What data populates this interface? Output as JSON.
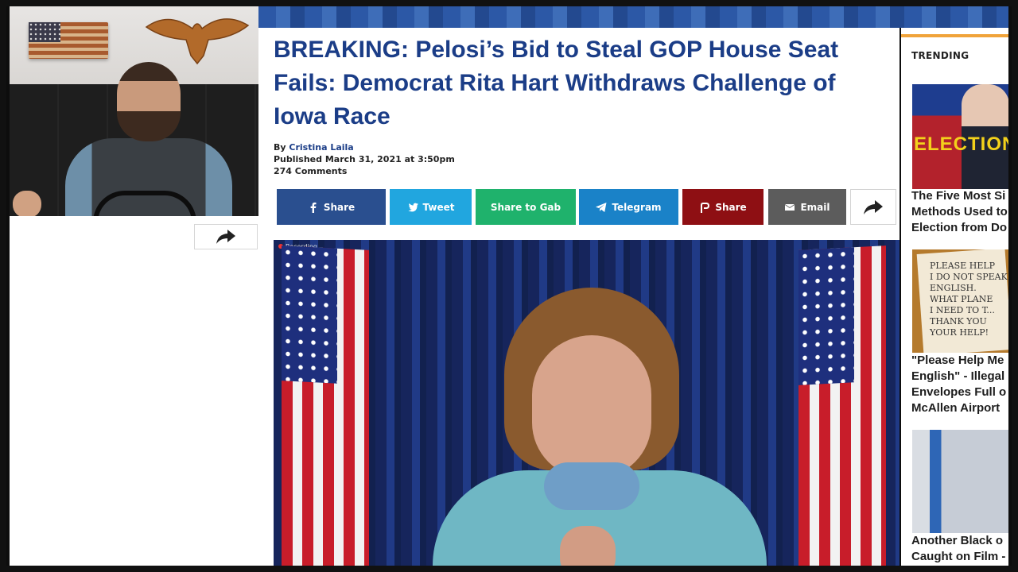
{
  "article": {
    "headline": "BREAKING: Pelosi’s Bid to Steal GOP House Seat Fails: Democrat Rita Hart Withdraws Challenge of Iowa Race",
    "by_prefix": "By ",
    "author": "Cristina Laila",
    "published": "Published March 31, 2021 at 3:50pm",
    "comments": "274 Comments"
  },
  "share": {
    "facebook": "Share",
    "twitter": "Tweet",
    "gab": "Share to Gab",
    "telegram": "Telegram",
    "parler": "Share",
    "email": "Email"
  },
  "photo": {
    "recording_label": "Recording..."
  },
  "trending": {
    "title": "TRENDING",
    "image_text_1": "ELECTION",
    "image_text_2": "PLEASE HELP\nI DO NOT SPEAK\nENGLISH.\nWHAT PLANE\nI NEED TO T...\nTHANK YOU\nYOUR HELP!",
    "items": [
      {
        "lines": [
          "The Five Most Si",
          "Methods Used to",
          "Election from Do"
        ]
      },
      {
        "lines": [
          "\"Please Help Me",
          "English\" - Illegal",
          "Envelopes Full o",
          "McAllen Airport"
        ]
      },
      {
        "lines": [
          "Another Black o",
          "Caught on Film -"
        ]
      }
    ]
  },
  "colors": {
    "headline": "#1b3d87",
    "facebook": "#2a4f8f",
    "twitter": "#21a6df",
    "gab": "#1fb26c",
    "telegram": "#1a82c8",
    "parler": "#8e0f13",
    "email": "#5c5c5c",
    "trending_accent": "#f0a33a"
  }
}
